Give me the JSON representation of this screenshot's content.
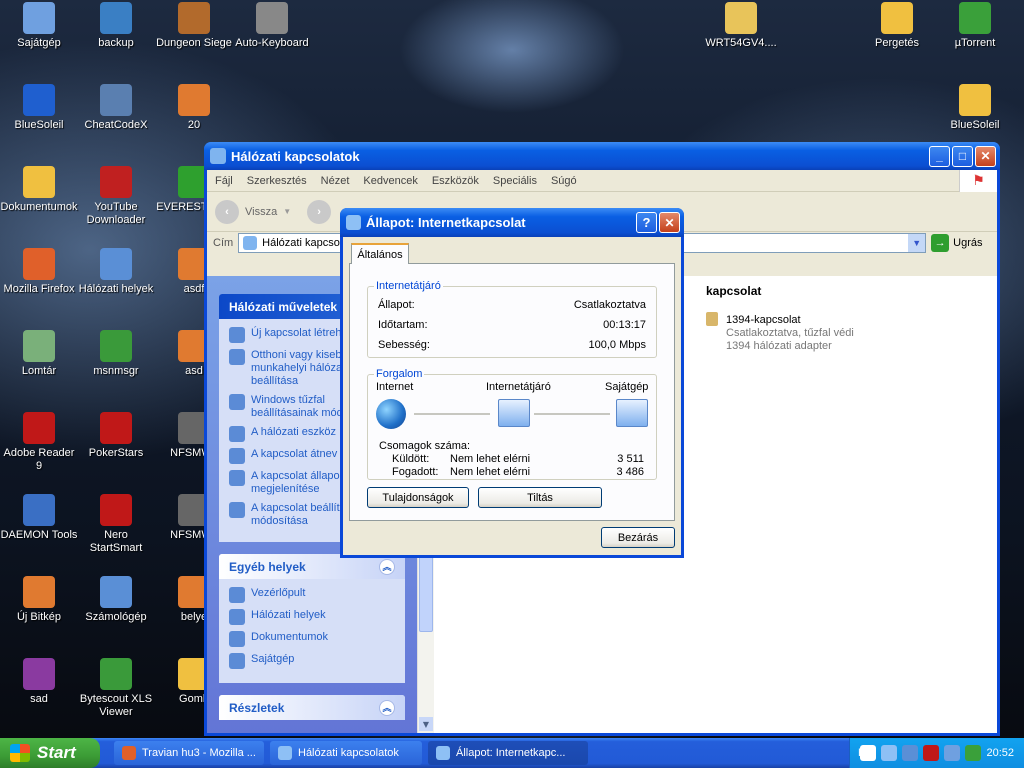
{
  "desktop_icons": [
    {
      "label": "Sajátgép",
      "icon": "computer-icon",
      "color": "#6fa0e0"
    },
    {
      "label": "backup",
      "icon": "backup-icon",
      "color": "#3a7fc4"
    },
    {
      "label": "Dungeon Siege",
      "icon": "game-icon",
      "color": "#b26a2c"
    },
    {
      "label": "Auto-Keyboard",
      "icon": "keyboard-icon",
      "color": "#888888"
    },
    {
      "label": "WRT54GV4....",
      "icon": "zip-folder-icon",
      "color": "#e8c45a"
    },
    {
      "label": "Pergetés",
      "icon": "folder-icon",
      "color": "#f0c040"
    },
    {
      "label": "µTorrent",
      "icon": "utorrent-icon",
      "color": "#3aa03a"
    },
    {
      "label": "BlueSoleil",
      "icon": "bluetooth-icon",
      "color": "#1f5fcf"
    },
    {
      "label": "CheatCodeX",
      "icon": "app-icon",
      "color": "#5a7fb0"
    },
    {
      "label": "20",
      "icon": "image-icon",
      "color": "#e07a30"
    },
    {
      "label": "BlueSoleil",
      "icon": "folder-icon",
      "color": "#f0c040"
    },
    {
      "label": "Dokumentumok",
      "icon": "documents-folder-icon",
      "color": "#f0c040"
    },
    {
      "label": "YouTube Downloader",
      "icon": "download-icon",
      "color": "#c02020"
    },
    {
      "label": "EVEREST Editi",
      "icon": "info-icon",
      "color": "#2ea02e"
    },
    {
      "label": "Mozilla Firefox",
      "icon": "firefox-icon",
      "color": "#e0602a"
    },
    {
      "label": "Hálózati helyek",
      "icon": "network-places-icon",
      "color": "#5a8fd6"
    },
    {
      "label": "asdf",
      "icon": "image-icon",
      "color": "#e07a30"
    },
    {
      "label": "Lomtár",
      "icon": "recycle-bin-icon",
      "color": "#7ab07a"
    },
    {
      "label": "msnmsgr",
      "icon": "msn-icon",
      "color": "#3a9a3a"
    },
    {
      "label": "asd",
      "icon": "image-icon",
      "color": "#e07a30"
    },
    {
      "label": "Adobe Reader 9",
      "icon": "pdf-icon",
      "color": "#c01818"
    },
    {
      "label": "PokerStars",
      "icon": "poker-icon",
      "color": "#c01818"
    },
    {
      "label": "NFSMW_",
      "icon": "image-icon",
      "color": "#666666"
    },
    {
      "label": "DAEMON Tools",
      "icon": "daemon-tools-icon",
      "color": "#3a6fc4"
    },
    {
      "label": "Nero StartSmart",
      "icon": "nero-icon",
      "color": "#c01818"
    },
    {
      "label": "NFSMW_",
      "icon": "image-icon",
      "color": "#666666"
    },
    {
      "label": "Új Bitkép",
      "icon": "bitmap-icon",
      "color": "#e07a30"
    },
    {
      "label": "Számológép",
      "icon": "calculator-icon",
      "color": "#5a8fd6"
    },
    {
      "label": "belye",
      "icon": "image-icon",
      "color": "#e07a30"
    },
    {
      "label": "sad",
      "icon": "winrar-icon",
      "color": "#8a3aa0"
    },
    {
      "label": "Bytescout XLS Viewer",
      "icon": "xls-viewer-icon",
      "color": "#3a9a3a"
    },
    {
      "label": "Gomb",
      "icon": "folder-icon",
      "color": "#f0c040"
    }
  ],
  "window": {
    "title": "Hálózati kapcsolatok",
    "min": "_",
    "max": "□",
    "close": "✕",
    "menu": [
      "Fájl",
      "Szerkesztés",
      "Nézet",
      "Kedvencek",
      "Eszközök",
      "Speciális",
      "Súgó"
    ],
    "back_label": "Vissza",
    "address_label": "Cím",
    "address_value": "Hálózati kapcsolat",
    "go_label": "Ugrás",
    "tasks_title": "Hálózati műveletek",
    "tasks": [
      "Új kapcsolat létrehozása",
      "Otthoni vagy kisebb munkahelyi hálózat beállítása",
      "Windows tűzfal beállításainak módosítása",
      "A hálózati eszköz",
      "A kapcsolat átnev",
      "A kapcsolat állapo megjelenítése",
      "A kapcsolat beállításainak módosítása"
    ],
    "other_title": "Egyéb helyek",
    "other": [
      "Vezérlőpult",
      "Hálózati helyek",
      "Dokumentumok",
      "Sajátgép"
    ],
    "details_title": "Részletek",
    "content_header": "kapcsolat",
    "item_name": "1394-kapcsolat",
    "item_status": "Csatlakoztatva, tűzfal védi",
    "item_device": "1394 hálózati adapter"
  },
  "dialog": {
    "title": "Állapot: Internetkapcsolat",
    "help": "?",
    "close": "✕",
    "tab": "Általános",
    "gateway_group": "Internetátjáró",
    "rows": [
      {
        "label": "Állapot:",
        "value": "Csatlakoztatva"
      },
      {
        "label": "Időtartam:",
        "value": "00:13:17"
      },
      {
        "label": "Sebesség:",
        "value": "100,0 Mbps"
      }
    ],
    "traffic_group": "Forgalom",
    "nodes": [
      "Internet",
      "Internetátjáró",
      "Sajátgép"
    ],
    "packets_label": "Csomagok száma:",
    "sent_label": "Küldött:",
    "sent_mid": "Nem lehet elérni",
    "sent_value": "3 511",
    "recv_label": "Fogadott:",
    "recv_mid": "Nem lehet elérni",
    "recv_value": "3 486",
    "properties_btn": "Tulajdonságok",
    "disable_btn": "Tiltás",
    "close_btn": "Bezárás"
  },
  "taskbar": {
    "start": "Start",
    "buttons": [
      {
        "label": "Travian hu3 - Mozilla ...",
        "icon": "firefox-icon",
        "color": "#e0602a"
      },
      {
        "label": "Hálózati kapcsolatok",
        "icon": "network-icon",
        "color": "#8ec0f5"
      },
      {
        "label": "Állapot: Internetkapc...",
        "icon": "network-icon",
        "color": "#8ec0f5"
      }
    ],
    "lang": "HU",
    "clock": "20:52"
  }
}
